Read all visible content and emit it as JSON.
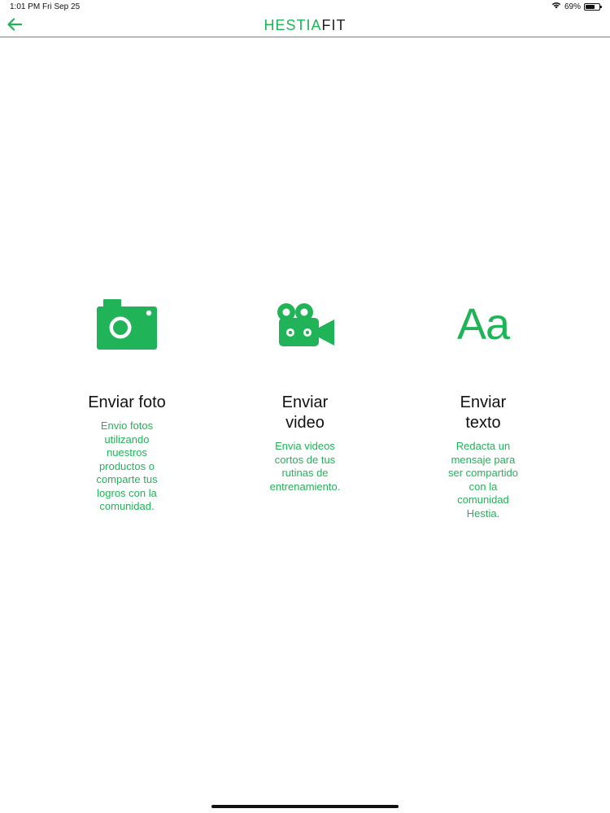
{
  "status_bar": {
    "time": "1:01 PM",
    "date": "Fri Sep 25",
    "battery_text": "69%",
    "battery_level": 0.69
  },
  "nav": {
    "brand_primary": "HESTIA",
    "brand_secondary": "FIT",
    "back_icon": "arrow-left-icon"
  },
  "colors": {
    "accent": "#21b358",
    "text": "#111111",
    "background": "#ffffff"
  },
  "options": [
    {
      "icon": "camera-icon",
      "title_line1": "Enviar foto",
      "title_line2": "",
      "description_lines": [
        "Envio fotos",
        "utilizando",
        "nuestros",
        "productos o",
        "comparte tus",
        "logros con la",
        "comunidad."
      ]
    },
    {
      "icon": "video-camera-icon",
      "title_line1": "Enviar",
      "title_line2": "video",
      "description_lines": [
        "Envia videos",
        "cortos de tus",
        "rutinas de",
        "entrenamiento."
      ]
    },
    {
      "icon": "text-aa-icon",
      "icon_text": "Aa",
      "title_line1": "Enviar",
      "title_line2": "texto",
      "description_lines": [
        "Redacta un",
        "mensaje para",
        "ser compartido",
        "con la",
        "comunidad",
        "Hestia."
      ]
    }
  ]
}
